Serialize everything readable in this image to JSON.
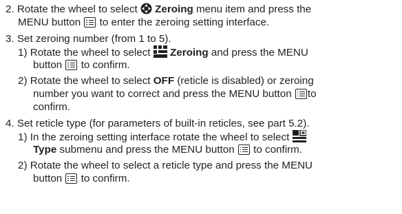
{
  "steps": [
    {
      "n": "2.",
      "lines": [
        {
          "t1": "Rotate the wheel to select ",
          "b": "Zeroing",
          "t2": " menu item and press the"
        },
        {
          "t1": "MENU button ",
          "t2": " to enter the zeroing setting interface."
        }
      ]
    },
    {
      "n": "3.",
      "text": "Set zeroing number (from 1 to 5).",
      "sub": [
        {
          "n": "1)",
          "lines": [
            {
              "t1": "Rotate the wheel to select ",
              "b": "Zeroing",
              "t2": " and press the MENU"
            },
            {
              "t1": "button ",
              "t2": " to confirm."
            }
          ]
        },
        {
          "n": "2)",
          "lines": [
            {
              "t1": "Rotate the wheel to select ",
              "b": "OFF",
              "t2": " (reticle is disabled) or zeroing"
            },
            {
              "t1": "number you want to correct and press the MENU button ",
              "t2": "to"
            },
            {
              "t1": "confirm."
            }
          ]
        }
      ]
    },
    {
      "n": "4.",
      "text": "Set reticle type (for parameters of built-in reticles, see part 5.2).",
      "sub": [
        {
          "n": "1)",
          "lines": [
            {
              "t1": "In the zeroing setting interface rotate the wheel to select"
            },
            {
              "b": "Type",
              "t2": " submenu and press the MENU button ",
              "t3": " to confirm."
            }
          ]
        },
        {
          "n": "2)",
          "lines": [
            {
              "t1": "Rotate the wheel to select a reticle type and press the MENU"
            },
            {
              "t1": "button ",
              "t2": " to confirm."
            }
          ]
        }
      ]
    }
  ],
  "icons": [
    "zeroing-menu-icon",
    "menu-button-icon",
    "zeroing-number-icon",
    "reticle-type-icon"
  ]
}
